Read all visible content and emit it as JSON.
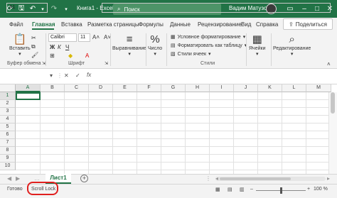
{
  "titlebar": {
    "title": "Книга1 - Excel",
    "search_placeholder": "Поиск",
    "user_name": "Вадим Матузок",
    "controls": [
      "minimize-icon",
      "maximize-icon",
      "close-icon"
    ]
  },
  "ribbon_tabs": [
    "Файл",
    "Главная",
    "Вставка",
    "Разметка страницы",
    "Формулы",
    "Данные",
    "Рецензирование",
    "Вид",
    "Справка"
  ],
  "active_tab": "Главная",
  "share_label": "Поделиться",
  "ribbon": {
    "clipboard": {
      "paste_label": "Вставить",
      "group_label": "Буфер обмена"
    },
    "font": {
      "font_name": "Calibri",
      "font_size": "11",
      "group_label": "Шрифт",
      "bold": "Ж",
      "italic": "К",
      "underline": "Ч"
    },
    "alignment": {
      "label": "Выравнивание"
    },
    "number": {
      "label": "Число"
    },
    "styles": {
      "items": [
        "Условное форматирование",
        "Форматировать как таблицу",
        "Стили ячеек"
      ],
      "group_label": "Стили"
    },
    "cells": {
      "label": "Ячейки"
    },
    "editing": {
      "label": "Редактирование"
    }
  },
  "formula_bar": {
    "name_box": "A1",
    "fx_label": "fx",
    "formula": ""
  },
  "grid": {
    "columns": [
      "A",
      "B",
      "C",
      "D",
      "E",
      "F",
      "G",
      "H",
      "I",
      "J",
      "K",
      "L",
      "M"
    ],
    "rows": [
      "1",
      "2",
      "3",
      "4",
      "5",
      "6",
      "7",
      "8",
      "9",
      "10"
    ],
    "selected_cell": "A1"
  },
  "sheets": {
    "tabs": [
      "Лист1"
    ],
    "active": "Лист1"
  },
  "status_bar": {
    "ready": "Готово",
    "scroll_lock": "Scroll Lock",
    "zoom": "100 %"
  },
  "colors": {
    "accent": "#217346",
    "highlight": "#e0201f"
  }
}
